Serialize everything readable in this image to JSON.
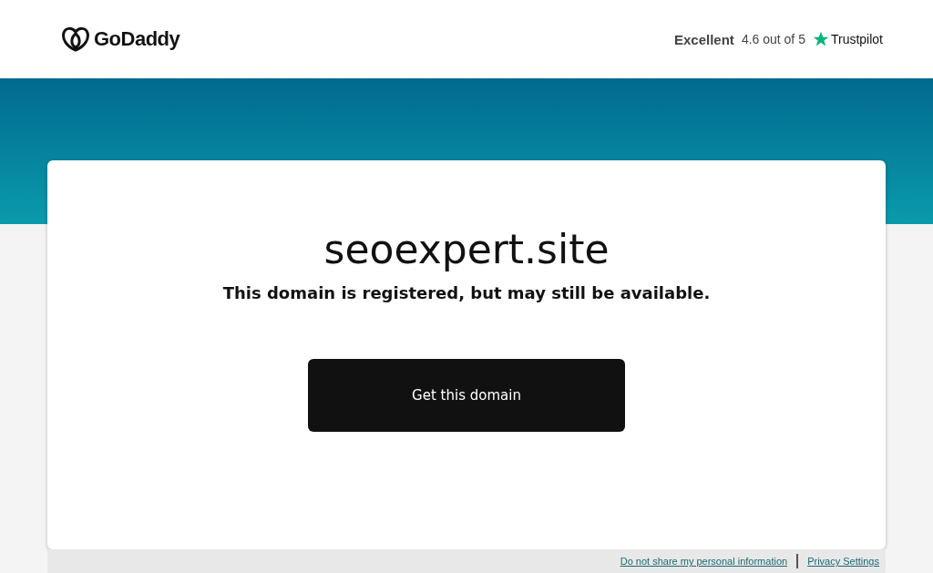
{
  "header": {
    "logo": "GoDaddy",
    "rating": {
      "label": "Excellent",
      "score": "4.6 out of 5",
      "brand": "Trustpilot"
    }
  },
  "card": {
    "domain": "seoexpert.site",
    "message": "This domain is registered, but may still be available.",
    "button": "Get this domain"
  },
  "footer": {
    "links": [
      "Do not share my personal information",
      "Privacy Settings"
    ]
  }
}
